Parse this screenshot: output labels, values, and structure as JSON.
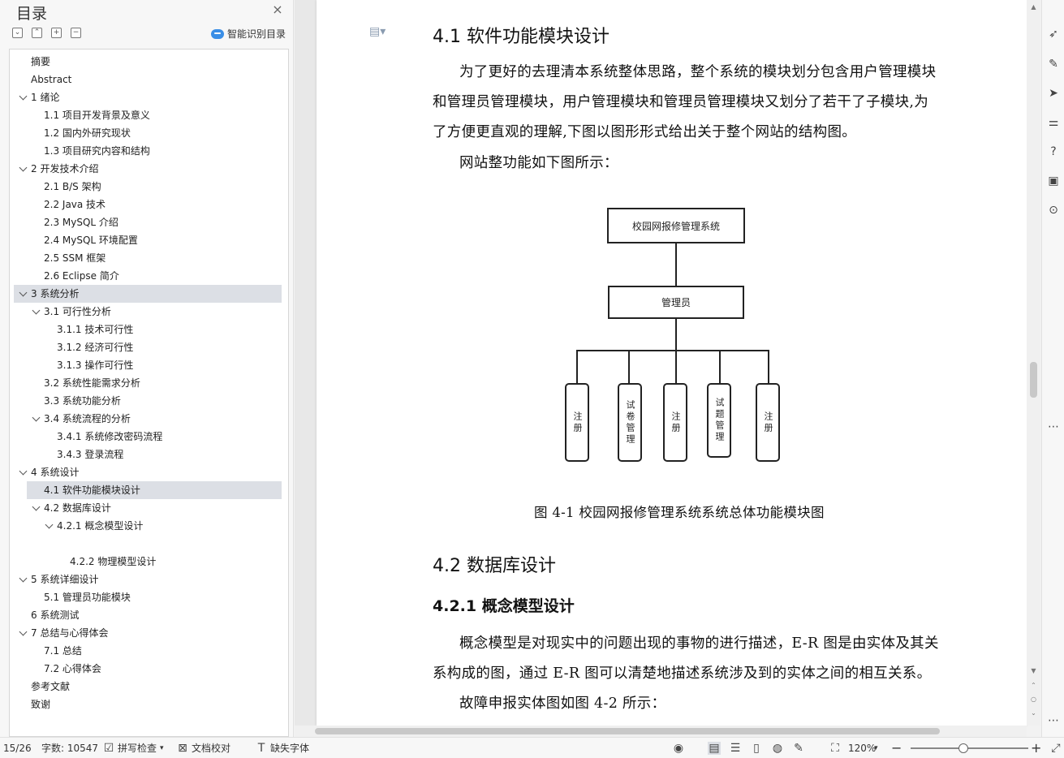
{
  "sidebar": {
    "title": "目录",
    "smart_toc_label": "智能识别目录",
    "items": [
      {
        "label": "摘要",
        "level": 0,
        "expandable": false,
        "selected": false
      },
      {
        "label": "Abstract",
        "level": 0,
        "expandable": false,
        "selected": false
      },
      {
        "label": "1 绪论",
        "level": 0,
        "expandable": true,
        "selected": false
      },
      {
        "label": "1.1 项目开发背景及意义",
        "level": 1,
        "expandable": false,
        "selected": false
      },
      {
        "label": "1.2 国内外研究现状",
        "level": 1,
        "expandable": false,
        "selected": false
      },
      {
        "label": "1.3 项目研究内容和结构",
        "level": 1,
        "expandable": false,
        "selected": false
      },
      {
        "label": "2 开发技术介绍",
        "level": 0,
        "expandable": true,
        "selected": false
      },
      {
        "label": "2.1 B/S 架构",
        "level": 1,
        "expandable": false,
        "selected": false
      },
      {
        "label": "2.2 Java 技术",
        "level": 1,
        "expandable": false,
        "selected": false
      },
      {
        "label": "2.3 MySQL 介绍",
        "level": 1,
        "expandable": false,
        "selected": false
      },
      {
        "label": "2.4 MySQL 环境配置",
        "level": 1,
        "expandable": false,
        "selected": false
      },
      {
        "label": "2.5 SSM 框架",
        "level": 1,
        "expandable": false,
        "selected": false
      },
      {
        "label": "2.6 Eclipse 简介",
        "level": 1,
        "expandable": false,
        "selected": false
      },
      {
        "label": "3 系统分析",
        "level": 0,
        "expandable": true,
        "selected": true
      },
      {
        "label": "3.1 可行性分析",
        "level": 1,
        "expandable": true,
        "selected": false
      },
      {
        "label": "3.1.1 技术可行性",
        "level": 2,
        "expandable": false,
        "selected": false
      },
      {
        "label": "3.1.2 经济可行性",
        "level": 2,
        "expandable": false,
        "selected": false
      },
      {
        "label": "3.1.3 操作可行性",
        "level": 2,
        "expandable": false,
        "selected": false
      },
      {
        "label": "3.2 系统性能需求分析",
        "level": 1,
        "expandable": false,
        "selected": false
      },
      {
        "label": "3.3 系统功能分析",
        "level": 1,
        "expandable": false,
        "selected": false
      },
      {
        "label": "3.4 系统流程的分析",
        "level": 1,
        "expandable": true,
        "selected": false
      },
      {
        "label": "3.4.1 系统修改密码流程",
        "level": 2,
        "expandable": false,
        "selected": false
      },
      {
        "label": "3.4.3  登录流程",
        "level": 2,
        "expandable": false,
        "selected": false
      },
      {
        "label": "4 系统设计",
        "level": 0,
        "expandable": true,
        "selected": false
      },
      {
        "label": "4.1  软件功能模块设计",
        "level": 1,
        "expandable": false,
        "selected": true
      },
      {
        "label": "4.2 数据库设计",
        "level": 1,
        "expandable": true,
        "selected": false
      },
      {
        "label": "4.2.1 概念模型设计",
        "level": 2,
        "expandable": true,
        "selected": false
      },
      {
        "label": "",
        "level": 3,
        "expandable": false,
        "selected": false
      },
      {
        "label": "4.2.2 物理模型设计",
        "level": 3,
        "expandable": false,
        "selected": false
      },
      {
        "label": "5 系统详细设计",
        "level": 0,
        "expandable": true,
        "selected": false
      },
      {
        "label": "5.1 管理员功能模块",
        "level": 1,
        "expandable": false,
        "selected": false
      },
      {
        "label": "6 系统测试",
        "level": 0,
        "expandable": false,
        "selected": false
      },
      {
        "label": "7 总结与心得体会",
        "level": 0,
        "expandable": true,
        "selected": false
      },
      {
        "label": "7.1  总结",
        "level": 1,
        "expandable": false,
        "selected": false
      },
      {
        "label": "7.2  心得体会",
        "level": 1,
        "expandable": false,
        "selected": false
      },
      {
        "label": "参考文献",
        "level": 0,
        "expandable": false,
        "selected": false
      },
      {
        "label": "致谢",
        "level": 0,
        "expandable": false,
        "selected": false
      }
    ]
  },
  "document": {
    "heading_41": "4.1  软件功能模块设计",
    "para1_line1": "为了更好的去理清本系统整体思路，整个系统的模块划分包含用户管理模块",
    "para1_line2": "和管理员管理模块，用户管理模块和管理员管理模块又划分了若干了子模块,为",
    "para1_line3": "了方便更直观的理解,下图以图形形式给出关于整个网站的结构图。",
    "para2": "网站整功能如下图所示：",
    "diagram": {
      "root": "校园网报修管理系统",
      "mid": "管理员",
      "leaves": [
        "注册",
        "试卷管理",
        "注册",
        "试题管理",
        "注册"
      ]
    },
    "figure_caption": "图 4-1 校园网报修管理系统系统总体功能模块图",
    "heading_42": "4.2 数据库设计",
    "heading_421": "4.2.1 概念模型设计",
    "para3_line1": "概念模型是对现实中的问题出现的事物的进行描述，E-R 图是由实体及其关",
    "para3_line2": "系构成的图，通过 E-R 图可以清楚地描述系统涉及到的实体之间的相互关系。",
    "para4": "故障申报实体图如图 4-2 所示："
  },
  "statusbar": {
    "page": "15/26",
    "word_count": "字数: 10547",
    "spell_check": "拼写检查",
    "doc_proof": "文档校对",
    "missing_fonts": "缺失字体",
    "zoom": "120%",
    "zoom_fraction": 0.45
  }
}
